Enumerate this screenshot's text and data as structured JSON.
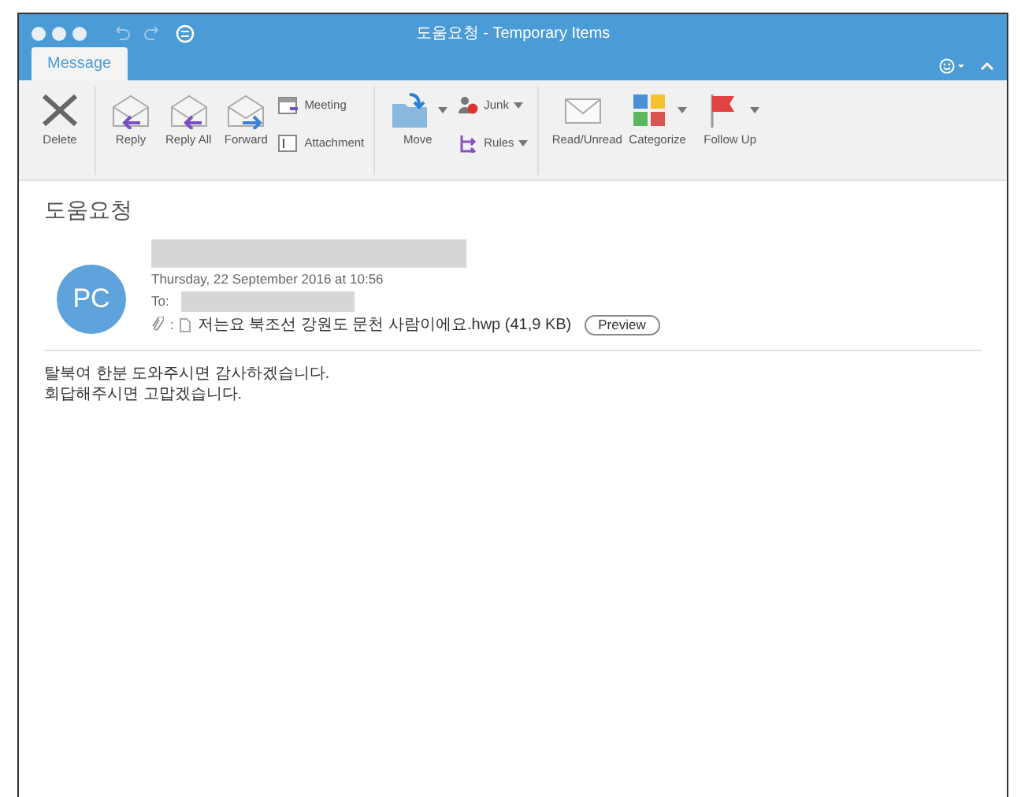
{
  "window": {
    "title": "도움요청 - Temporary Items"
  },
  "tabs": [
    {
      "label": "Message",
      "selected": true
    }
  ],
  "ribbon": {
    "groups": [
      {
        "items": [
          {
            "kind": "large",
            "label": "Delete",
            "dropdown": false
          }
        ]
      },
      {
        "items": [
          {
            "kind": "large",
            "label": "Reply",
            "dropdown": false
          },
          {
            "kind": "large",
            "label": "Reply All",
            "dropdown": false
          },
          {
            "kind": "large",
            "label": "Forward",
            "dropdown": false
          },
          {
            "kind": "stack",
            "buttons": [
              {
                "label": "Meeting",
                "dropdown": false
              },
              {
                "label": "Attachment",
                "dropdown": false
              }
            ]
          }
        ]
      },
      {
        "items": [
          {
            "kind": "large",
            "label": "Move",
            "dropdown": true
          },
          {
            "kind": "stack",
            "buttons": [
              {
                "label": "Junk",
                "dropdown": true
              },
              {
                "label": "Rules",
                "dropdown": true
              }
            ]
          }
        ]
      },
      {
        "items": [
          {
            "kind": "large",
            "label": "Read/Unread",
            "dropdown": false
          },
          {
            "kind": "large",
            "label": "Categorize",
            "dropdown": true
          },
          {
            "kind": "large",
            "label": "Follow Up",
            "dropdown": true
          }
        ]
      }
    ]
  },
  "message": {
    "subject": "도움요청",
    "avatar": "PC",
    "date": "Thursday, 22 September 2016 at 10:56",
    "to_label": "To:",
    "attachment": {
      "label": ":",
      "name": "저는요 북조선 강원도 문천 사람이에요.hwp (41,9 KB)",
      "preview": "Preview"
    },
    "body": [
      "탈북여 한분 도와주시면 감사하겠습니다.",
      "회답해주시면 고맙겠습니다."
    ]
  }
}
